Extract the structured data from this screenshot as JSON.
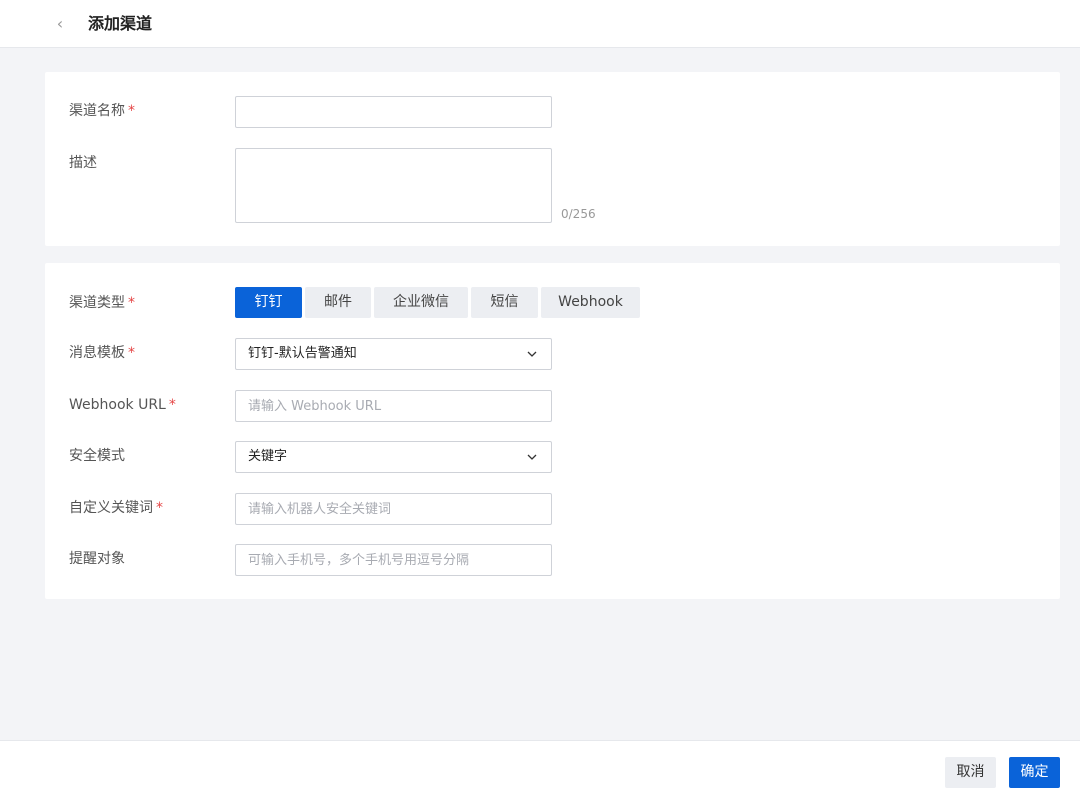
{
  "header": {
    "title": "添加渠道",
    "back_icon": "‹"
  },
  "basic": {
    "name_label": "渠道名称",
    "required_mark": "*",
    "name_value": "",
    "desc_label": "描述",
    "desc_value": "",
    "desc_counter": "0/256"
  },
  "channel": {
    "type_label": "渠道类型",
    "types": [
      "钉钉",
      "邮件",
      "企业微信",
      "短信",
      "Webhook"
    ],
    "selected_type": "钉钉",
    "template_label": "消息模板",
    "template_value": "钉钉-默认告警通知",
    "webhook_label": "Webhook URL",
    "webhook_placeholder": "请输入 Webhook URL",
    "security_label": "安全模式",
    "security_value": "关键字",
    "keyword_label": "自定义关键词",
    "keyword_placeholder": "请输入机器人安全关键词",
    "mention_label": "提醒对象",
    "mention_placeholder": "可输入手机号，多个手机号用逗号分隔"
  },
  "footer": {
    "cancel_label": "取消",
    "ok_label": "确定"
  },
  "colors": {
    "primary": "#0a63d9",
    "required": "#e54545",
    "background": "#f3f4f7"
  }
}
